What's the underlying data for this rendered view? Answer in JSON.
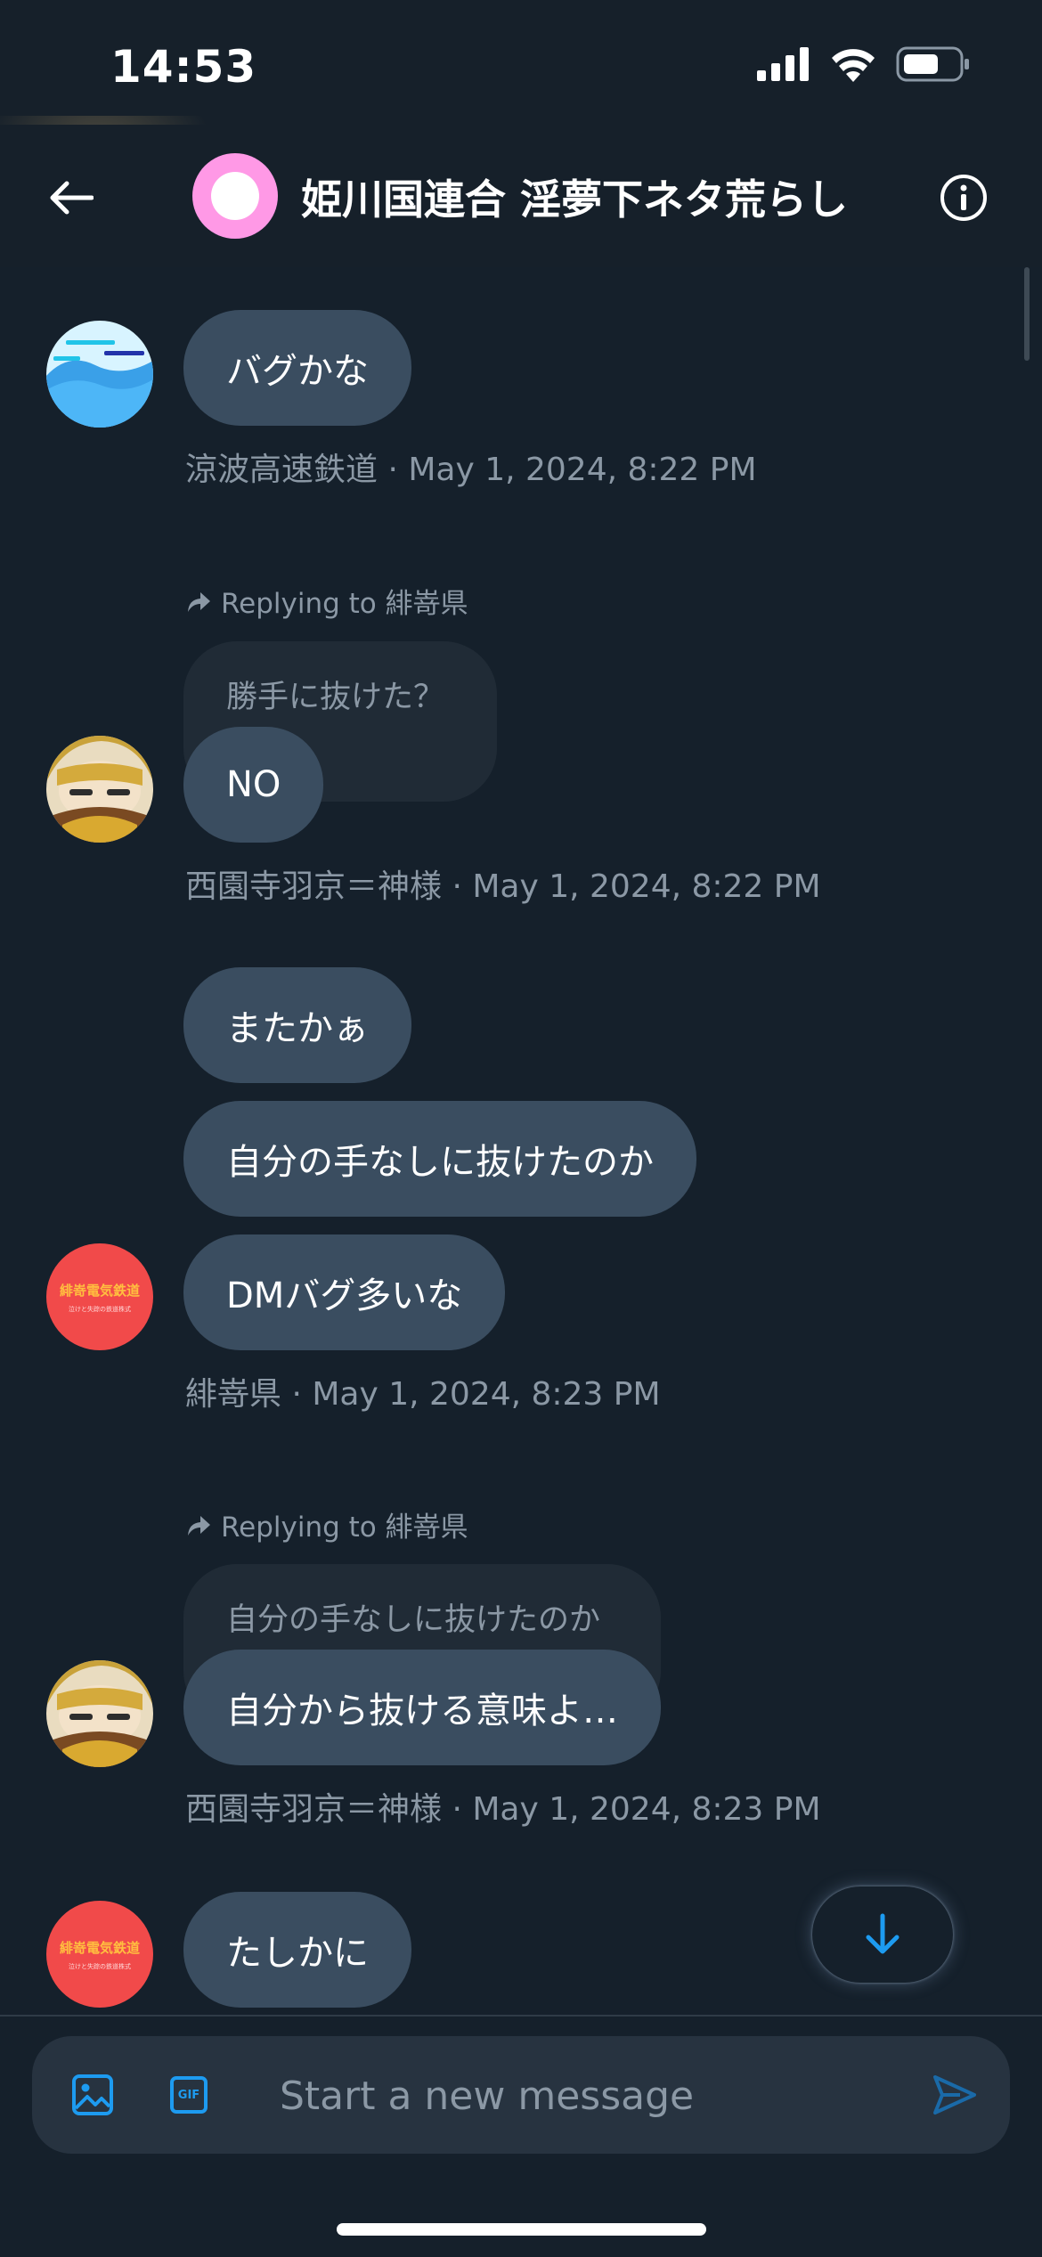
{
  "status_bar": {
    "time": "14:53"
  },
  "header": {
    "title": "姫川国連合 淫夢下ネタ荒らし"
  },
  "messages": [
    {
      "text": "バグかな",
      "meta": "涼波高速鉄道 · May 1, 2024, 8:22 PM"
    },
    {
      "reply_label": "Replying to 緋嵜県",
      "quoted": "勝手に抜けた？",
      "text": "NO",
      "meta": "西園寺羽京＝神様 · May 1, 2024, 8:22 PM"
    },
    {
      "texts": [
        "またかぁ",
        "自分の手なしに抜けたのか",
        "DMバグ多いな"
      ],
      "meta": "緋嵜県 · May 1, 2024, 8:23 PM"
    },
    {
      "reply_label": "Replying to 緋嵜県",
      "quoted": "自分の手なしに抜けたのか",
      "text": "自分から抜ける意味よ…",
      "meta": "西園寺羽京＝神様 · May 1, 2024, 8:23 PM"
    },
    {
      "text": "たしかに"
    }
  ],
  "avatars": {
    "railway_logo_text": "緋嵜電気鉄道",
    "railway_logo_subtext": "泣けと失踪の鉄道株式"
  },
  "composer": {
    "placeholder": "Start a new message",
    "gif_label": "GIF"
  },
  "colors": {
    "accent": "#1d9bf0",
    "background": "#15202b",
    "bubble": "#3a4d60",
    "muted": "#8b98a5"
  }
}
